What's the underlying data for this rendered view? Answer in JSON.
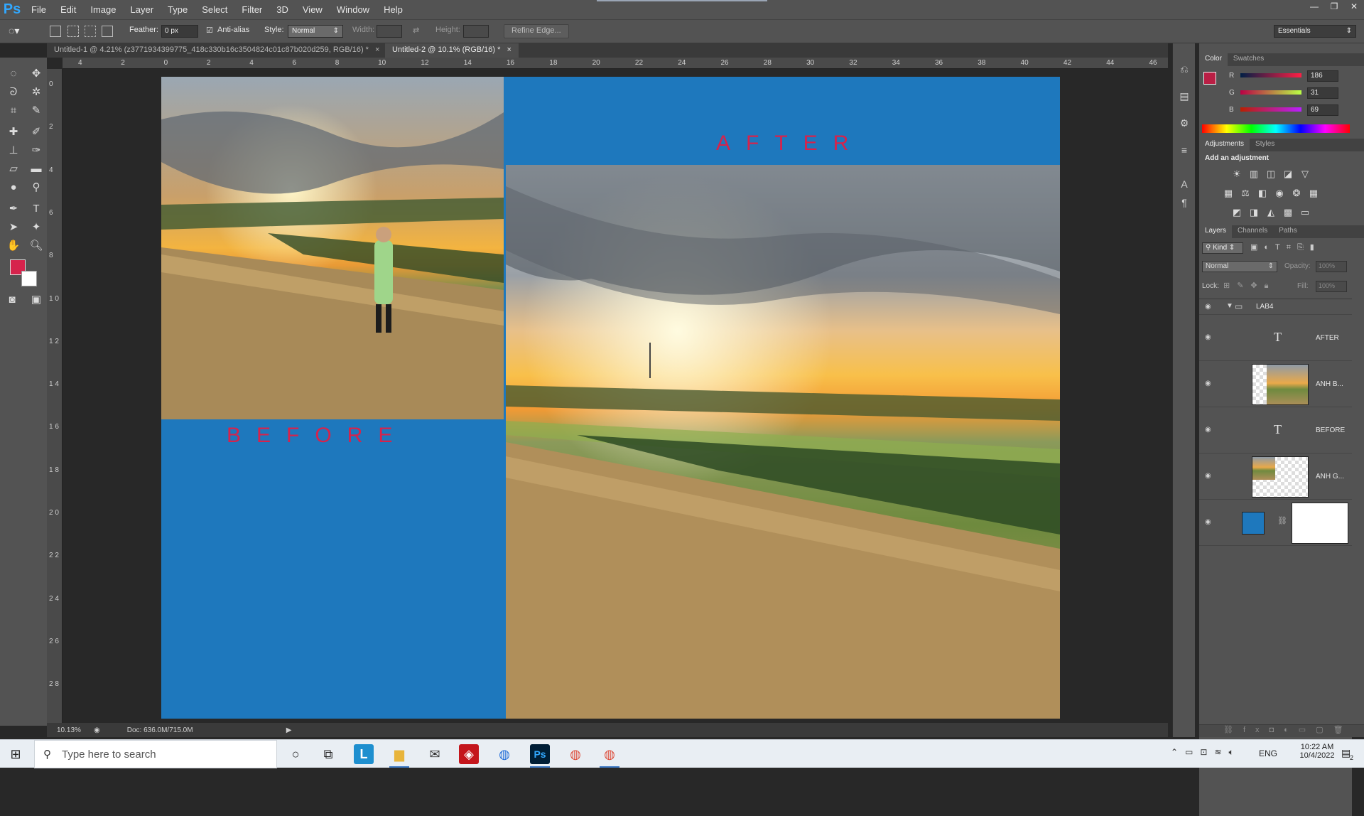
{
  "app": {
    "logo": "Ps",
    "menus": [
      "File",
      "Edit",
      "Image",
      "Layer",
      "Type",
      "Select",
      "Filter",
      "3D",
      "View",
      "Window",
      "Help"
    ]
  },
  "options": {
    "feather_label": "Feather:",
    "feather_value": "0 px",
    "antialias_label": "Anti-alias",
    "antialias_checked": true,
    "style_label": "Style:",
    "style_value": "Normal",
    "width_label": "Width:",
    "height_label": "Height:",
    "refine_label": "Refine Edge...",
    "workspace_value": "Essentials"
  },
  "tabs": [
    {
      "label": "Untitled-1 @ 4.21% (z3771934399775_418c330b16c3504824c01c87b020d259, RGB/16) *",
      "close": "×",
      "active": false
    },
    {
      "label": "Untitled-2 @ 10.1% (RGB/16) *",
      "close": "×",
      "active": true
    }
  ],
  "rulers": {
    "top": [
      "4",
      "2",
      "0",
      "2",
      "4",
      "6",
      "8",
      "10",
      "12",
      "14",
      "16",
      "18",
      "20",
      "22",
      "24",
      "26",
      "28",
      "30",
      "32",
      "34",
      "36",
      "38",
      "40",
      "42",
      "44",
      "46"
    ],
    "left": [
      "0",
      "2",
      "4",
      "6",
      "8",
      "1 0",
      "1 2",
      "1 4",
      "1 6",
      "1 8",
      "2 0",
      "2 2",
      "2 4",
      "2 6",
      "2 8",
      "3"
    ]
  },
  "canvas": {
    "background_color": "#1e78bd",
    "before_text": "BEFORE",
    "after_text": "AFTER",
    "text_color": "#d6234c"
  },
  "status": {
    "zoom": "10.13%",
    "doc": "Doc: 636.0M/715.0M"
  },
  "color_panel": {
    "tabs": [
      "Color",
      "Swatches"
    ],
    "r_label": "R",
    "r_value": "186",
    "g_label": "G",
    "g_value": "31",
    "b_label": "B",
    "b_value": "69",
    "foreground": "#ba1f45",
    "background": "#ffffff"
  },
  "adjustments_panel": {
    "tabs": [
      "Adjustments",
      "Styles"
    ],
    "heading": "Add an adjustment"
  },
  "layers_panel": {
    "tabs": [
      "Layers",
      "Channels",
      "Paths"
    ],
    "filter_kind": "Kind",
    "blend_mode": "Normal",
    "opacity_label": "Opacity:",
    "opacity_value": "100%",
    "lock_label": "Lock:",
    "fill_label": "Fill:",
    "fill_value": "100%",
    "group_name": "LAB4",
    "layers": [
      {
        "name": "AFTER",
        "kind": "text"
      },
      {
        "name": "ANH B...",
        "kind": "image"
      },
      {
        "name": "BEFORE",
        "kind": "text"
      },
      {
        "name": "ANH G...",
        "kind": "image"
      },
      {
        "name": "",
        "kind": "fill"
      }
    ]
  },
  "taskbar": {
    "search_placeholder": "Type here to search",
    "language": "ENG",
    "time": "10:22 AM",
    "date": "10/4/2022",
    "notification_count": "2"
  }
}
